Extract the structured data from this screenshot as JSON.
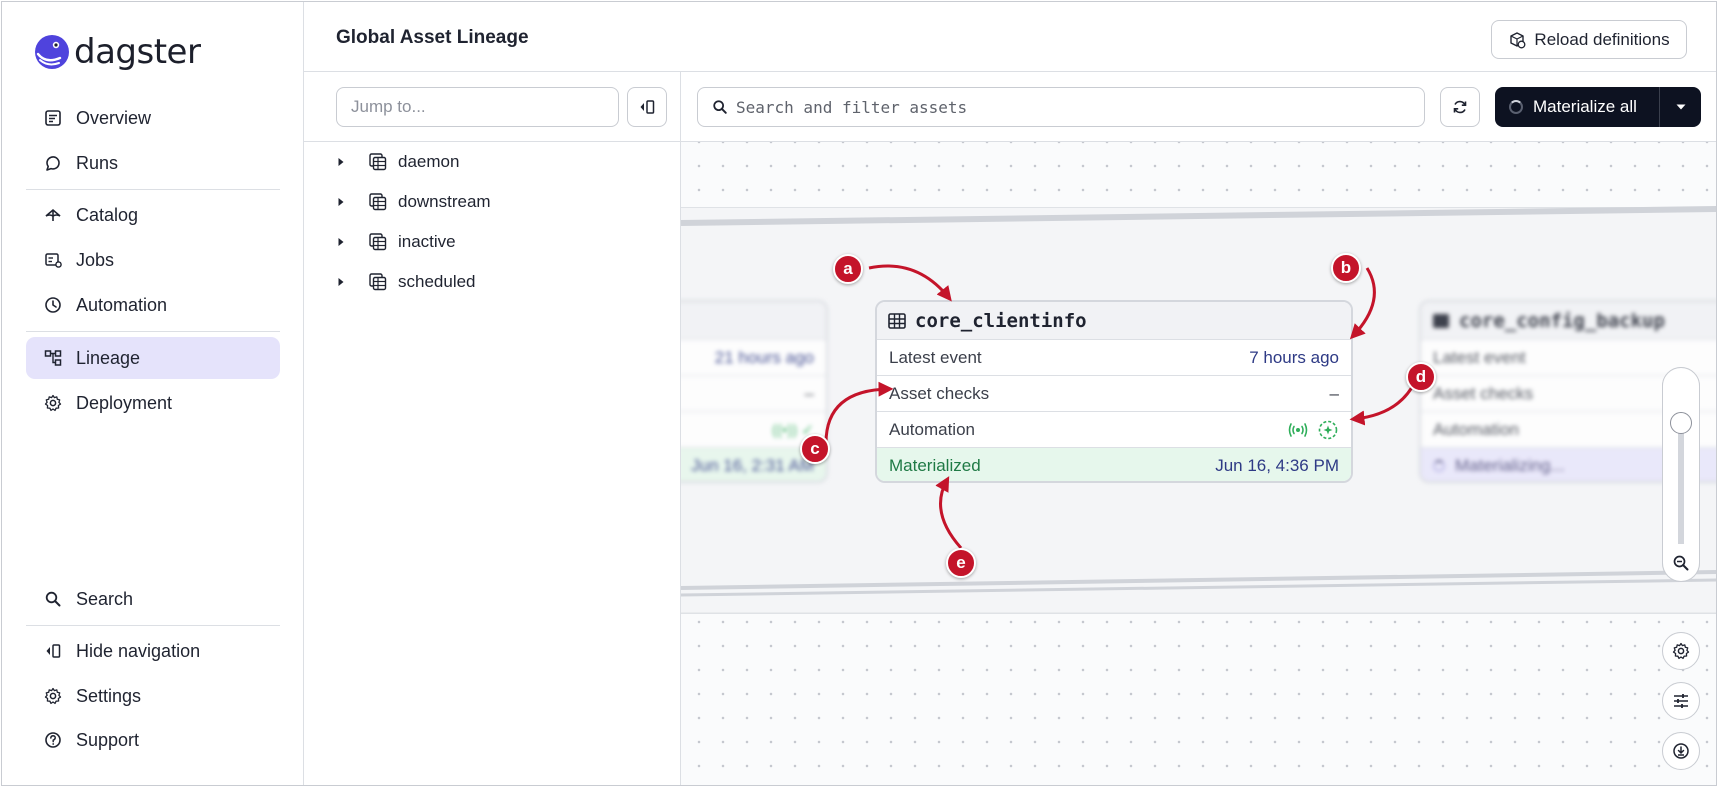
{
  "app": {
    "name": "dagster"
  },
  "sidebar": {
    "primary": [
      {
        "label": "Overview",
        "icon": "overview-icon"
      },
      {
        "label": "Runs",
        "icon": "runs-icon"
      }
    ],
    "secondary": [
      {
        "label": "Catalog",
        "icon": "catalog-icon"
      },
      {
        "label": "Jobs",
        "icon": "jobs-icon"
      },
      {
        "label": "Automation",
        "icon": "clock-icon"
      }
    ],
    "tertiary": [
      {
        "label": "Lineage",
        "icon": "lineage-icon",
        "active": true
      },
      {
        "label": "Deployment",
        "icon": "gear-icon"
      }
    ],
    "bottom": [
      {
        "label": "Search",
        "icon": "search-icon"
      },
      {
        "label": "Hide navigation",
        "icon": "hide-nav-icon"
      },
      {
        "label": "Settings",
        "icon": "gear-icon"
      },
      {
        "label": "Support",
        "icon": "help-icon"
      }
    ]
  },
  "header": {
    "title": "Global Asset Lineage",
    "reload_label": "Reload definitions"
  },
  "tree": {
    "jump_placeholder": "Jump to...",
    "groups": [
      "daemon",
      "downstream",
      "inactive",
      "scheduled"
    ]
  },
  "toolbar": {
    "search_placeholder": "Search and filter assets",
    "materialize_label": "Materialize all"
  },
  "cards": {
    "left": {
      "latest_event": "21 hours ago",
      "asset_checks": "–",
      "materialized": "Jun 16, 2:31 AM"
    },
    "main": {
      "title": "core_clientinfo",
      "latest_event_label": "Latest event",
      "latest_event": "7 hours ago",
      "asset_checks_label": "Asset checks",
      "asset_checks": "–",
      "automation_label": "Automation",
      "materialized_label": "Materialized",
      "materialized": "Jun 16, 4:36 PM"
    },
    "right": {
      "title": "core_config_backup",
      "latest_event_label": "Latest event",
      "asset_checks_label": "Asset checks",
      "automation_label": "Automation",
      "status_label": "Materializing..."
    }
  },
  "annotations": [
    "a",
    "b",
    "c",
    "d",
    "e"
  ],
  "colors": {
    "accent": "#4f43dd",
    "active_nav": "#e5e3fb",
    "primary_button": "#0d1221",
    "materialized_bg": "#e6f7ec",
    "annotation": "#c4142a"
  }
}
